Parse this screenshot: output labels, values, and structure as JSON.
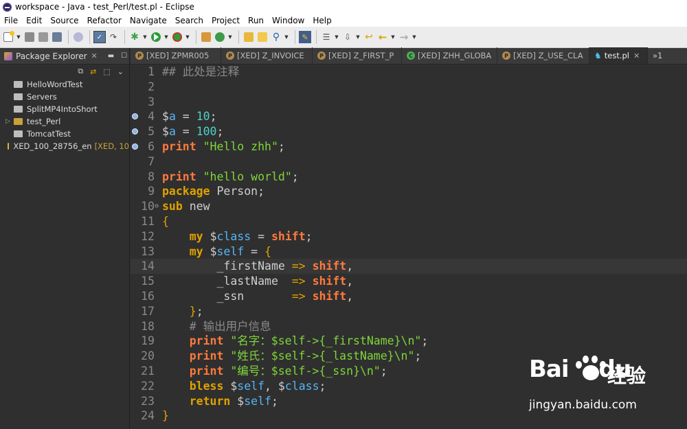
{
  "window": {
    "title": "workspace - Java - test_Perl/test.pl - Eclipse"
  },
  "menu": [
    "File",
    "Edit",
    "Source",
    "Refactor",
    "Navigate",
    "Search",
    "Project",
    "Run",
    "Window",
    "Help"
  ],
  "explorer": {
    "title": "Package Explorer",
    "close": "✕",
    "items": [
      {
        "label": "HelloWordTest",
        "type": "folder",
        "expandable": false
      },
      {
        "label": "Servers",
        "type": "folder",
        "expandable": false
      },
      {
        "label": "SplitMP4IntoShort",
        "type": "folder",
        "expandable": false
      },
      {
        "label": "test_Perl",
        "type": "project",
        "expandable": true
      },
      {
        "label": "TomcatTest",
        "type": "folder",
        "expandable": false
      },
      {
        "label": "XED_100_28756_en",
        "type": "open-project",
        "expandable": false,
        "decoration": "[XED, 10"
      }
    ]
  },
  "tabs": [
    {
      "label": "[XED] ZPMR005",
      "icon": "P",
      "active": false
    },
    {
      "label": "[XED] Z_INVOICE",
      "icon": "P",
      "active": false
    },
    {
      "label": "[XED] Z_FIRST_P",
      "icon": "P",
      "active": false
    },
    {
      "label": "[XED] ZHH_GLOBA",
      "icon": "C",
      "active": false
    },
    {
      "label": "[XED] Z_USE_CLA",
      "icon": "P",
      "active": false
    },
    {
      "label": "test.pl",
      "icon": "camel",
      "active": true
    }
  ],
  "tab_overflow": "»1",
  "editor": {
    "current_line": 14,
    "breakpoint_lines": [
      4,
      5,
      6
    ],
    "fold_line": 10,
    "lines": [
      [
        [
          "c",
          "## 此处是注释"
        ]
      ],
      [],
      [],
      [
        [
          "s",
          "$"
        ],
        [
          "v",
          "a"
        ],
        [
          "o",
          " = "
        ],
        [
          "n",
          "10"
        ],
        [
          "o",
          ";"
        ]
      ],
      [
        [
          "s",
          "$"
        ],
        [
          "v",
          "a"
        ],
        [
          "o",
          " = "
        ],
        [
          "n",
          "100"
        ],
        [
          "o",
          ";"
        ]
      ],
      [
        [
          "b",
          "print"
        ],
        [
          "o",
          " "
        ],
        [
          "str",
          "\"Hello zhh\""
        ],
        [
          "o",
          ";"
        ]
      ],
      [],
      [
        [
          "b",
          "print"
        ],
        [
          "o",
          " "
        ],
        [
          "str",
          "\"hello world\""
        ],
        [
          "o",
          ";"
        ]
      ],
      [
        [
          "k",
          "package"
        ],
        [
          "p",
          " Person"
        ],
        [
          "o",
          ";"
        ]
      ],
      [
        [
          "k",
          "sub"
        ],
        [
          "p",
          " new"
        ]
      ],
      [
        [
          "br",
          "{"
        ]
      ],
      [
        [
          "p",
          "    "
        ],
        [
          "k",
          "my"
        ],
        [
          "o",
          " "
        ],
        [
          "s",
          "$"
        ],
        [
          "v",
          "class"
        ],
        [
          "o",
          " = "
        ],
        [
          "b",
          "shift"
        ],
        [
          "o",
          ";"
        ]
      ],
      [
        [
          "p",
          "    "
        ],
        [
          "k",
          "my"
        ],
        [
          "o",
          " "
        ],
        [
          "s",
          "$"
        ],
        [
          "v",
          "self"
        ],
        [
          "o",
          " = "
        ],
        [
          "br",
          "{"
        ]
      ],
      [
        [
          "p",
          "        _firstName "
        ],
        [
          "a",
          "=>"
        ],
        [
          "o",
          " "
        ],
        [
          "b",
          "shift"
        ],
        [
          "o",
          ","
        ]
      ],
      [
        [
          "p",
          "        _lastName  "
        ],
        [
          "a",
          "=>"
        ],
        [
          "o",
          " "
        ],
        [
          "b",
          "shift"
        ],
        [
          "o",
          ","
        ]
      ],
      [
        [
          "p",
          "        _ssn       "
        ],
        [
          "a",
          "=>"
        ],
        [
          "o",
          " "
        ],
        [
          "b",
          "shift"
        ],
        [
          "o",
          ","
        ]
      ],
      [
        [
          "p",
          "    "
        ],
        [
          "br",
          "}"
        ],
        [
          "o",
          ";"
        ]
      ],
      [
        [
          "p",
          "    "
        ],
        [
          "c",
          "# 输出用户信息"
        ]
      ],
      [
        [
          "p",
          "    "
        ],
        [
          "b",
          "print"
        ],
        [
          "o",
          " "
        ],
        [
          "str",
          "\"名字：$self->{_firstName}\\n\""
        ],
        [
          "o",
          ";"
        ]
      ],
      [
        [
          "p",
          "    "
        ],
        [
          "b",
          "print"
        ],
        [
          "o",
          " "
        ],
        [
          "str",
          "\"姓氏：$self->{_lastName}\\n\""
        ],
        [
          "o",
          ";"
        ]
      ],
      [
        [
          "p",
          "    "
        ],
        [
          "b",
          "print"
        ],
        [
          "o",
          " "
        ],
        [
          "str",
          "\"编号：$self->{_ssn}\\n\""
        ],
        [
          "o",
          ";"
        ]
      ],
      [
        [
          "p",
          "    "
        ],
        [
          "k",
          "bless"
        ],
        [
          "o",
          " "
        ],
        [
          "s",
          "$"
        ],
        [
          "v",
          "self"
        ],
        [
          "o",
          ", "
        ],
        [
          "s",
          "$"
        ],
        [
          "v",
          "class"
        ],
        [
          "o",
          ";"
        ]
      ],
      [
        [
          "p",
          "    "
        ],
        [
          "k",
          "return"
        ],
        [
          "o",
          " "
        ],
        [
          "s",
          "$"
        ],
        [
          "v",
          "self"
        ],
        [
          "o",
          ";"
        ]
      ],
      [
        [
          "br",
          "}"
        ]
      ]
    ]
  },
  "watermark": {
    "logo_text": "Bai",
    "logo_text2": "du",
    "cn_text": "经验",
    "url": "jingyan.baidu.com"
  }
}
